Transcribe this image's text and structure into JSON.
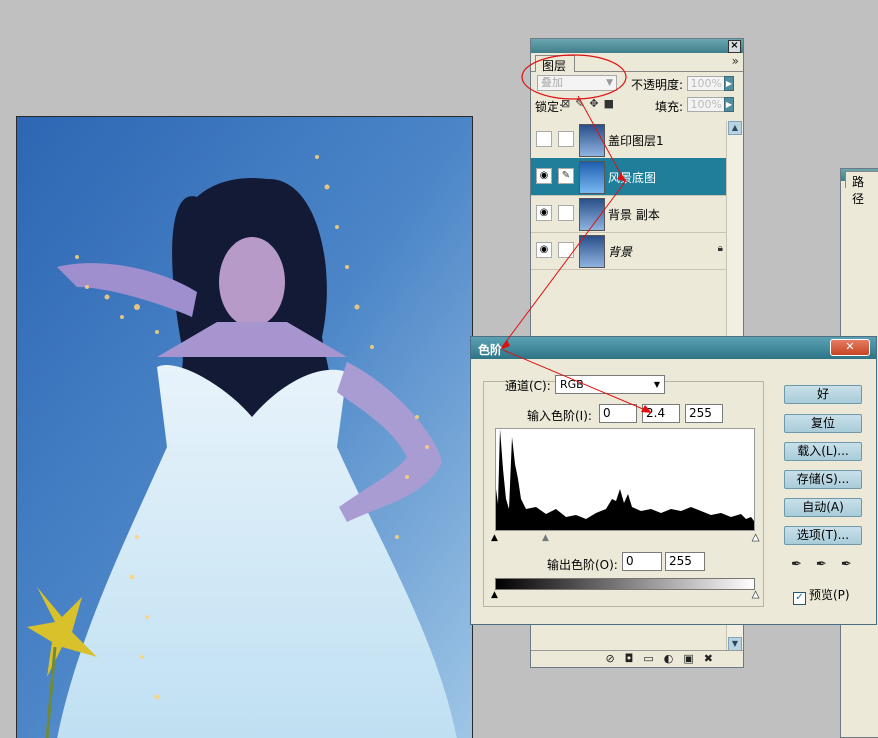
{
  "layers_panel": {
    "tab_label": "图层",
    "blend_mode": "叠加",
    "opacity_label": "不透明度:",
    "opacity_value": "100%",
    "lock_label": "锁定:",
    "fill_label": "填充:",
    "fill_value": "100%",
    "layers": [
      {
        "name": "盖印图层1",
        "visible": false,
        "selected": false
      },
      {
        "name": "风景底图",
        "visible": true,
        "selected": true
      },
      {
        "name": "背景 副本",
        "visible": true,
        "selected": false
      },
      {
        "name": "背景",
        "visible": true,
        "selected": false,
        "locked": true
      }
    ]
  },
  "paths_panel": {
    "tab_label": "路径"
  },
  "levels_dialog": {
    "title": "色阶",
    "channel_label": "通道(C):",
    "channel_value": "RGB",
    "input_label": "输入色阶(I):",
    "input_black": "0",
    "input_gamma": "2.4",
    "input_white": "255",
    "output_label": "输出色阶(O):",
    "output_black": "0",
    "output_white": "255",
    "buttons": {
      "ok": "好",
      "reset": "复位",
      "load": "载入(L)...",
      "save": "存储(S)...",
      "auto": "自动(A)",
      "options": "选项(T)..."
    },
    "preview_label": "预览(P)",
    "preview_checked": true
  },
  "colors": {
    "selected_layer": "#1f7e9a",
    "annotation_red": "#e01010"
  }
}
